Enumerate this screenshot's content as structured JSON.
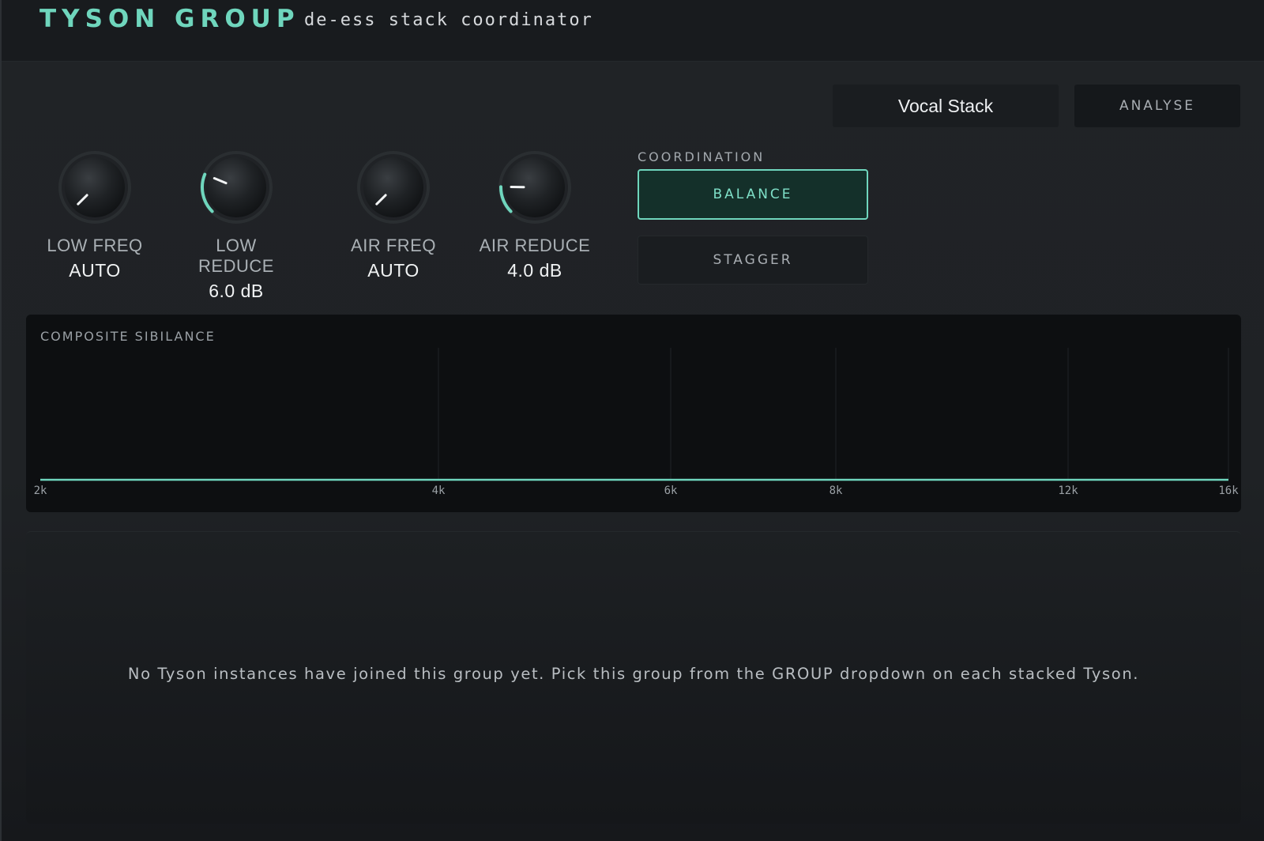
{
  "header": {
    "brand": "TYSON GROUP",
    "subtitle": "de-ess stack coordinator"
  },
  "toolbar": {
    "group_name": "Vocal Stack",
    "analyse_label": "ANALYSE"
  },
  "knobs": [
    {
      "label": "LOW FREQ",
      "value": "AUTO",
      "level": 0.0
    },
    {
      "label": "LOW REDUCE",
      "value": "6.0 dB",
      "level": 0.25
    },
    {
      "label": "AIR FREQ",
      "value": "AUTO",
      "level": 0.0
    },
    {
      "label": "AIR REDUCE",
      "value": "4.0 dB",
      "level": 0.17
    }
  ],
  "coordination": {
    "label": "COORDINATION",
    "modes": [
      "BALANCE",
      "STAGGER"
    ],
    "selected": "BALANCE"
  },
  "spectrum": {
    "title": "COMPOSITE SIBILANCE",
    "x_ticks": [
      "2k",
      "4k",
      "6k",
      "8k",
      "12k",
      "16k"
    ]
  },
  "members": {
    "empty_message": "No Tyson instances have joined this group yet. Pick this group from the GROUP dropdown on each stacked Tyson."
  },
  "colors": {
    "accent": "#6fd6bd",
    "knob_body": "#1c1f22",
    "background": "#1f2225"
  }
}
